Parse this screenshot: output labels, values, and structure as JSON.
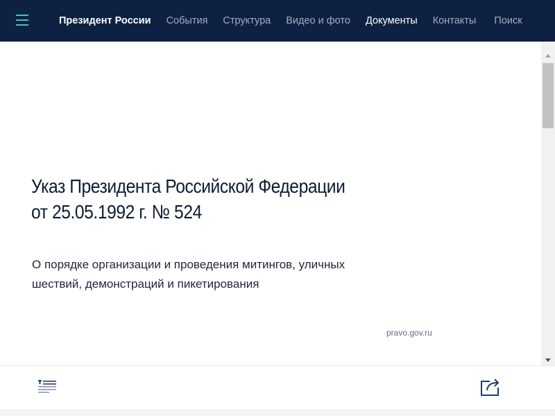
{
  "nav": {
    "menu_icon": "hamburger-menu-icon",
    "brand": "Президент России",
    "items": [
      {
        "label": "События",
        "active": false
      },
      {
        "label": "Структура",
        "active": false
      },
      {
        "label": "Видео и фото",
        "active": false
      },
      {
        "label": "Документы",
        "active": true
      },
      {
        "label": "Контакты",
        "active": false
      }
    ],
    "search": "Поиск"
  },
  "document": {
    "title_line1": "Указ Президента Российской Федерации",
    "title_line2": "от 25.05.1992 г. № 524",
    "subtitle_line1": "О порядке организации и проведения митингов, уличных",
    "subtitle_line2": "шествий, демонстраций и пикетирования",
    "source": "pravo.gov.ru"
  },
  "toolbar": {
    "toc_icon": "table-of-contents-icon",
    "share_icon": "share-icon"
  },
  "colors": {
    "header_bg": "#0f2142",
    "accent": "#3ec6c1",
    "nav_inactive": "#a2adbf",
    "toolbar_icon": "#1d3a6e"
  }
}
